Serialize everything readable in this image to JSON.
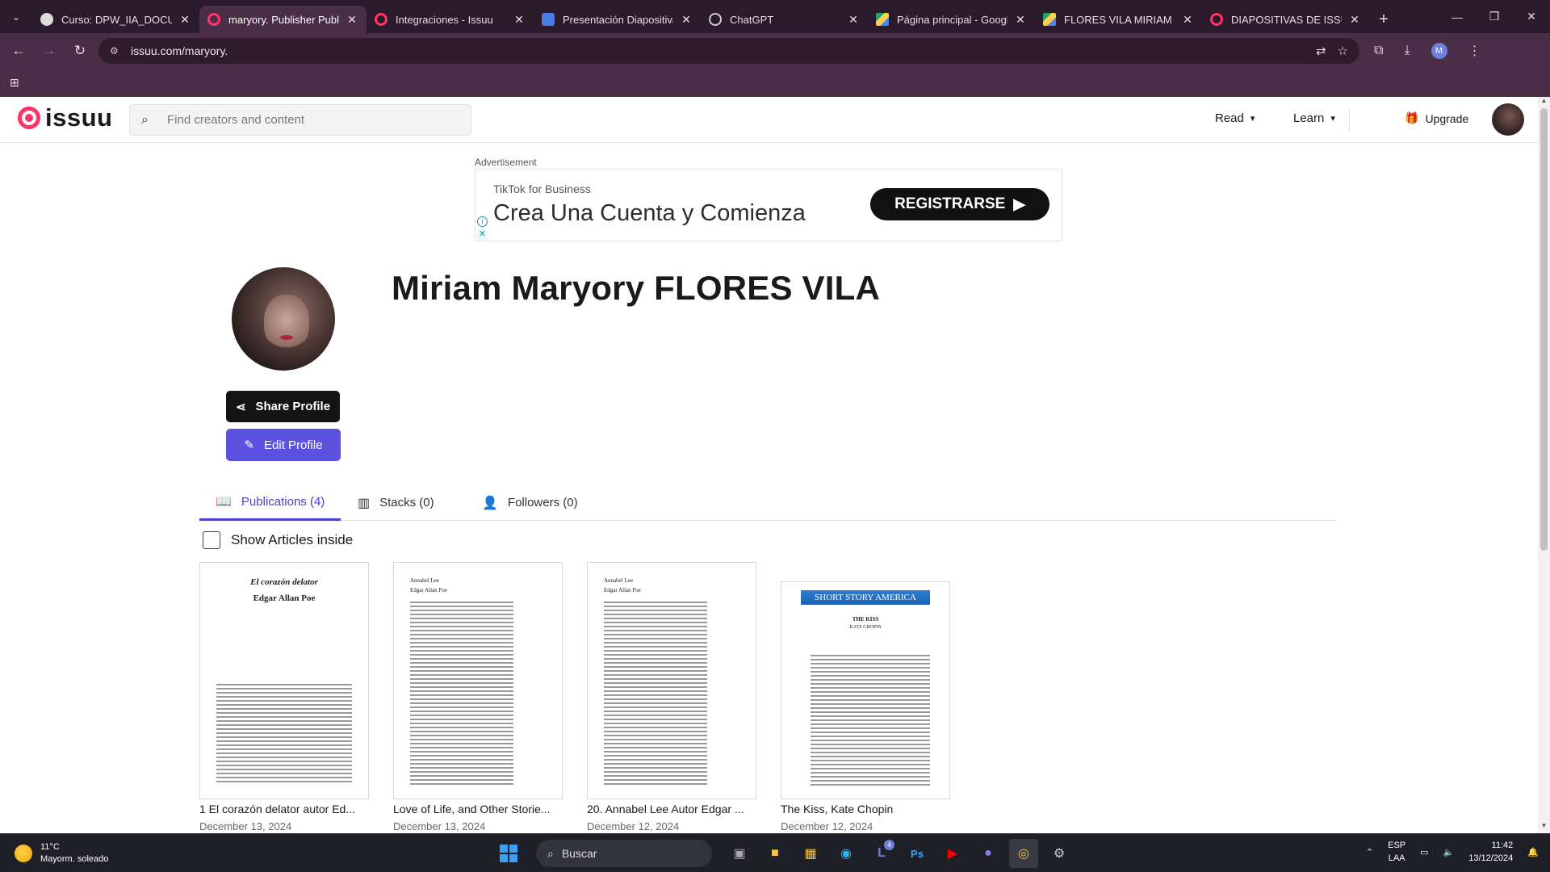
{
  "browser": {
    "tabs": [
      {
        "title": "Curso: DPW_IIA_DOCUMEN",
        "favicon": "#ddd",
        "active": false
      },
      {
        "title": "maryory. Publisher Public",
        "favicon": "#f36",
        "active": true
      },
      {
        "title": "Integraciones - Issuu",
        "favicon": "#f36",
        "active": false
      },
      {
        "title": "Presentación Diapositivas",
        "favicon": "#4a7be0",
        "active": false
      },
      {
        "title": "ChatGPT",
        "favicon": "#bbb",
        "active": false
      },
      {
        "title": "Página principal - Google",
        "favicon": "#1fa463",
        "active": false
      },
      {
        "title": "FLORES VILA MIRIAM MA",
        "favicon": "#1fa463",
        "active": false
      },
      {
        "title": "DIAPOSITIVAS DE ISSUU",
        "favicon": "#f36",
        "active": false
      }
    ],
    "url": "issuu.com/maryory.",
    "profile_initial": "M"
  },
  "header": {
    "logo_text": "issuu",
    "search_placeholder": "Find creators and content",
    "nav": {
      "read": "Read",
      "learn": "Learn"
    },
    "upgrade": "Upgrade"
  },
  "ad": {
    "label": "Advertisement",
    "brand": "TikTok for Business",
    "headline": "Crea Una Cuenta y Comienza",
    "cta": "REGISTRARSE"
  },
  "profile": {
    "name": "Miriam Maryory FLORES VILA",
    "share_label": "Share Profile",
    "edit_label": "Edit Profile"
  },
  "tabs": {
    "publications": "Publications (4)",
    "stacks": "Stacks (0)",
    "followers": "Followers (0)"
  },
  "filter": {
    "show_articles": "Show Articles inside"
  },
  "publications": [
    {
      "title": "1 El corazón delator autor Ed...",
      "date": "December 13, 2024",
      "cover_title": "El corazón delator",
      "cover_author": "Edgar Allan Poe"
    },
    {
      "title": "Love of Life, and Other Storie...",
      "date": "December 13, 2024",
      "cover_title": "Annabel Lee",
      "cover_author": "Edgar Allan Poe"
    },
    {
      "title": "20. Annabel Lee Autor Edgar ...",
      "date": "December 12, 2024",
      "cover_title": "Annabel Lee",
      "cover_author": "Edgar Allan Poe"
    },
    {
      "title": "The Kiss, Kate Chopin",
      "date": "December 12, 2024",
      "cover_banner": "SHORT STORY AMERICA",
      "cover_title": "THE KISS",
      "cover_author": "KATE CHOPIN"
    }
  ],
  "taskbar": {
    "temperature": "11°C",
    "weather": "Mayorm. soleado",
    "search": "Buscar",
    "teams_badge": "4",
    "lang_top": "ESP",
    "lang_bottom": "LAA",
    "time": "11:42",
    "date": "13/12/2024"
  }
}
